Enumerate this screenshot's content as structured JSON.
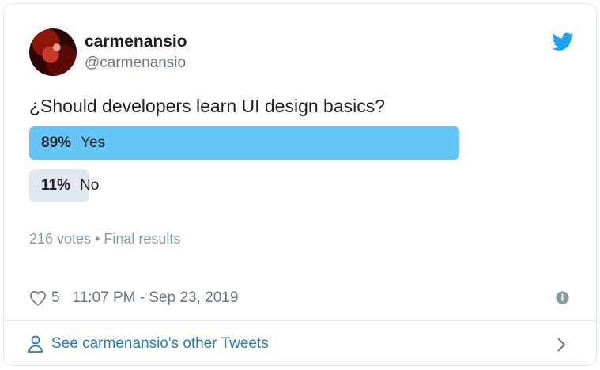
{
  "tweet": {
    "display_name": "carmenansio",
    "handle": "@carmenansio",
    "question": "¿Should developers learn UI design basics?",
    "poll": {
      "options": [
        {
          "percent_label": "89%",
          "label": "Yes",
          "fraction": 0.89,
          "winner": true
        },
        {
          "percent_label": "11%",
          "label": "No",
          "fraction": 0.11,
          "winner": false
        }
      ],
      "summary": "216 votes • Final results"
    },
    "likes": "5",
    "timestamp": "11:07 PM - Sep 23, 2019",
    "see_more": "See carmenansio's other Tweets"
  },
  "colors": {
    "winner_bar": "#66c5f7",
    "other_bar": "#e1e8ed",
    "link": "#2b7bb9",
    "brand": "#1da1f2"
  },
  "icons": [
    "twitter-bird-icon",
    "heart-icon",
    "info-icon",
    "person-icon",
    "chevron-right-icon"
  ]
}
